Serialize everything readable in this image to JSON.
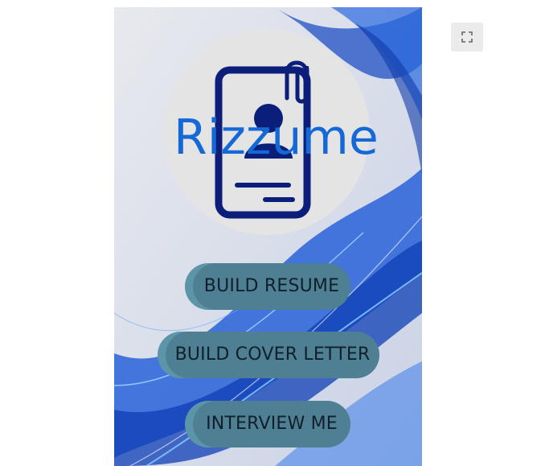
{
  "app": {
    "logo_text": "Rizzume",
    "brand_color": "#1569d6",
    "icon_color": "#0b1f7a"
  },
  "buttons": {
    "build_resume": "BUILD RESUME",
    "build_cover_letter": "BUILD COVER LETTER",
    "interview_me": "INTERVIEW ME",
    "button_color": "#4f7f93"
  },
  "controls": {
    "fullscreen_icon": "fullscreen-icon"
  }
}
